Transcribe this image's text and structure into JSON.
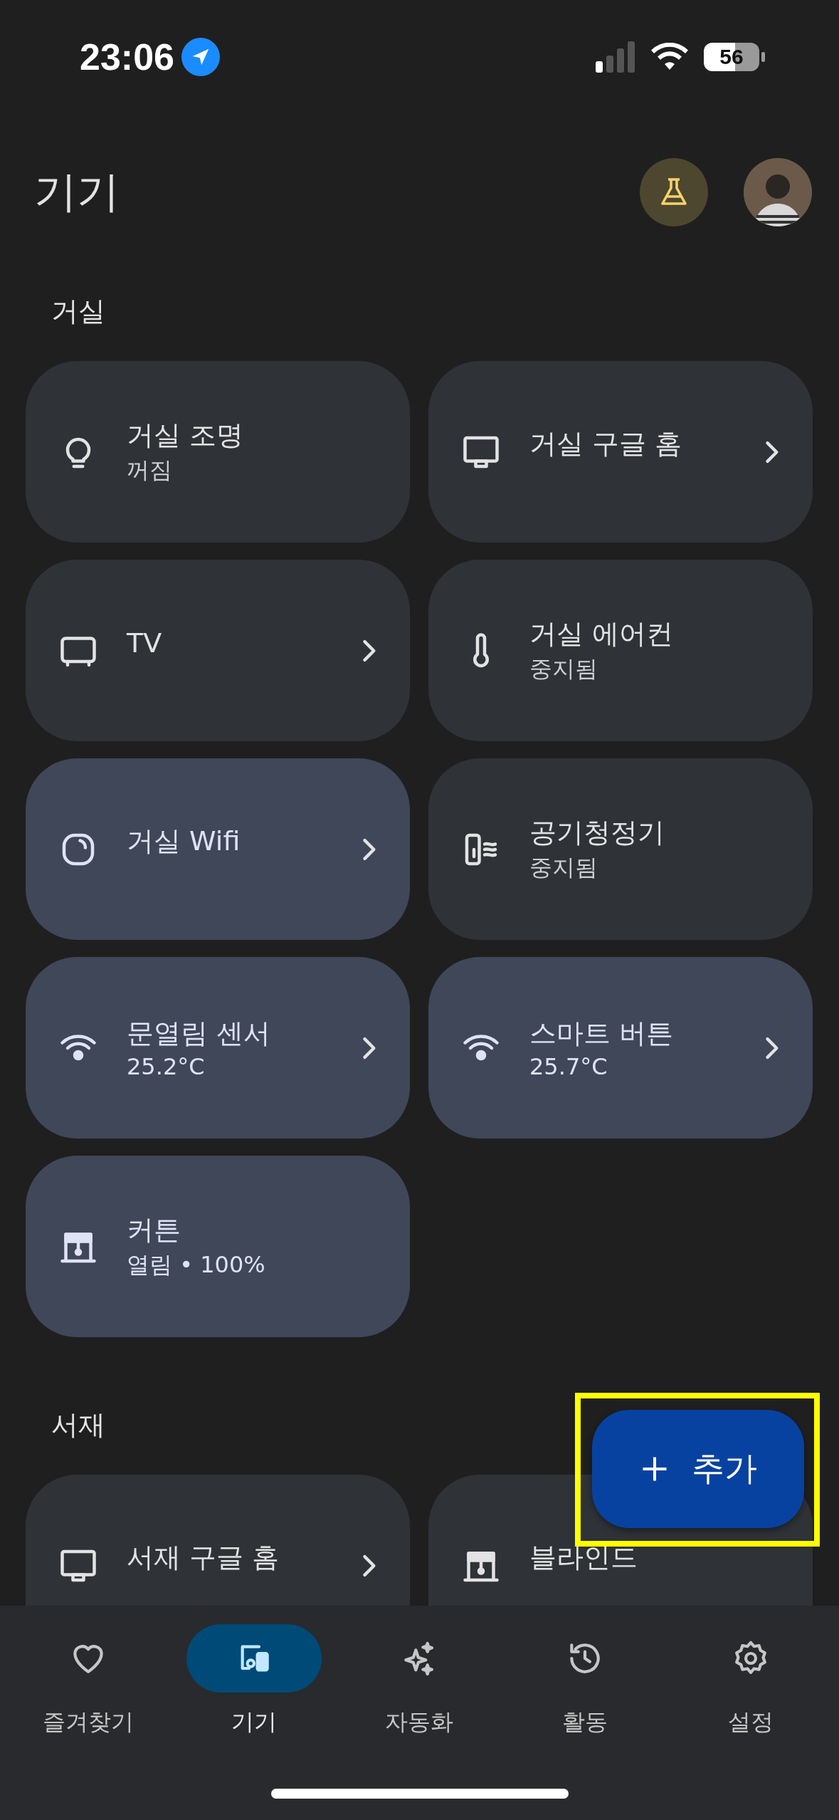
{
  "status_bar": {
    "time": "23:06",
    "battery": "56"
  },
  "header": {
    "title": "기기"
  },
  "sections": [
    {
      "title": "거실",
      "devices": [
        {
          "name": "거실 조명",
          "status": "꺼짐",
          "kind": "bulb",
          "chevron": false,
          "on": false
        },
        {
          "name": "거실 구글 홈",
          "kind": "display",
          "chevron": true,
          "on": false
        },
        {
          "name": "TV",
          "kind": "tv",
          "chevron": true,
          "on": false
        },
        {
          "name": "거실 에어컨",
          "status": "중지됨",
          "kind": "thermometer",
          "chevron": false,
          "on": false
        },
        {
          "name": "거실 Wifi",
          "kind": "router",
          "chevron": true,
          "on": true
        },
        {
          "name": "공기청정기",
          "status": "중지됨",
          "kind": "purifier",
          "chevron": false,
          "on": false
        },
        {
          "name": "문열림 센서",
          "status": "25.2°C",
          "kind": "sensor",
          "chevron": true,
          "on": true
        },
        {
          "name": "스마트 버튼",
          "status": "25.7°C",
          "kind": "sensor",
          "chevron": true,
          "on": true
        },
        {
          "name": "커튼",
          "status": "열림 • 100%",
          "kind": "curtain",
          "chevron": false,
          "on": true
        }
      ]
    },
    {
      "title": "서재",
      "devices": [
        {
          "name": "서재 구글 홈",
          "kind": "display",
          "chevron": true,
          "on": false
        },
        {
          "name": "블라인드",
          "kind": "curtain",
          "chevron": false,
          "on": false
        }
      ]
    }
  ],
  "fab": {
    "label": "추가",
    "highlighted": true
  },
  "nav": [
    {
      "label": "즐겨찾기",
      "kind": "heart",
      "selected": false
    },
    {
      "label": "기기",
      "kind": "devices",
      "selected": true
    },
    {
      "label": "자동화",
      "kind": "sparkle",
      "selected": false
    },
    {
      "label": "활동",
      "kind": "history",
      "selected": false
    },
    {
      "label": "설정",
      "kind": "gear",
      "selected": false
    }
  ]
}
